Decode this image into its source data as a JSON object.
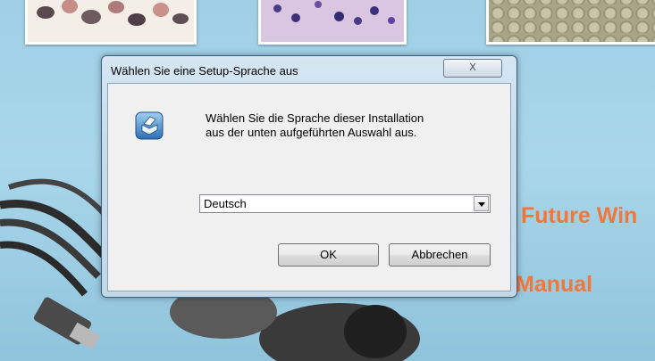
{
  "background": {
    "heading_fragment": "Future Win",
    "subheading_fragment": "Manual"
  },
  "dialog": {
    "title": "Wählen Sie eine Setup-Sprache aus",
    "close_glyph": "X",
    "message_line1": "Wählen Sie die Sprache dieser Installation",
    "message_line2": "aus der unten aufgeführten Auswahl aus.",
    "selected_language": "Deutsch",
    "ok_label": "OK",
    "cancel_label": "Abbrechen",
    "icon": "setup-package-icon"
  },
  "colors": {
    "background_text": "#f2773a",
    "splash_blue": "#a9d6ea",
    "dialog_frame": "#c7dbeb",
    "client_area": "#f0f0f0"
  }
}
